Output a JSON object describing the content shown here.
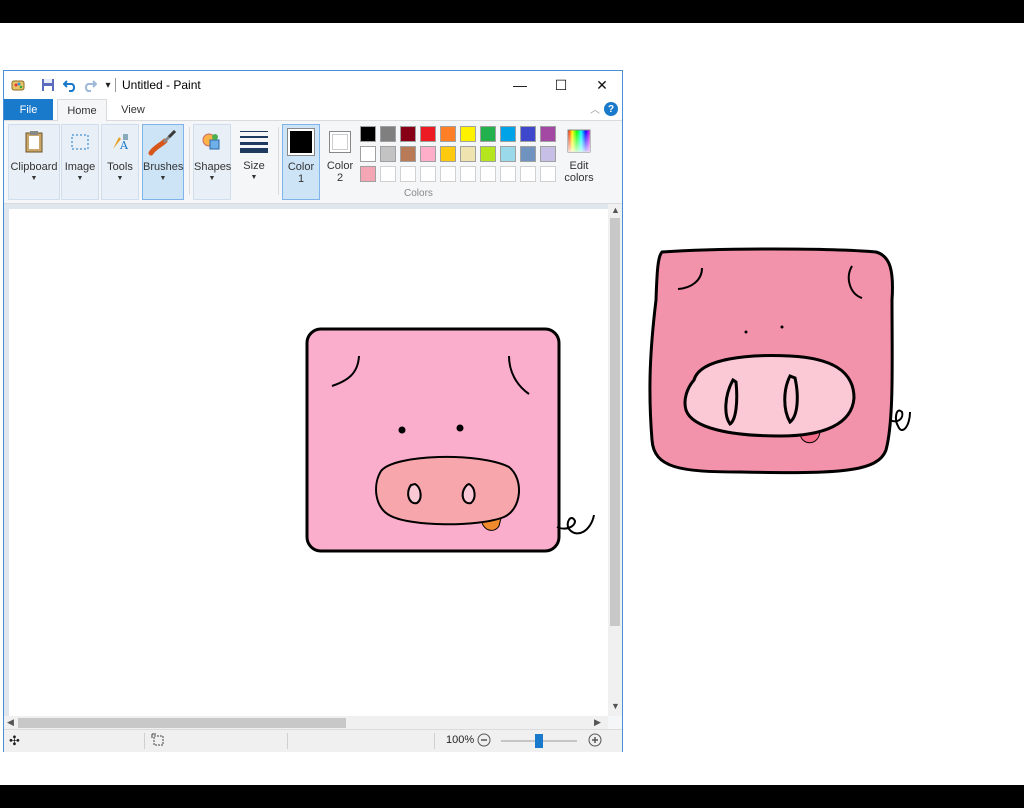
{
  "window": {
    "title": "Untitled - Paint",
    "minimize_glyph": "—",
    "maximize_glyph": "☐",
    "close_glyph": "✕"
  },
  "quick_access": {
    "app_icon": "paint-app-icon",
    "save_icon": "save-icon",
    "undo_icon": "undo-icon",
    "redo_icon": "redo-icon",
    "customize_icon": "customize-dropdown-icon"
  },
  "menu": {
    "file": "File",
    "tabs": [
      {
        "label": "Home",
        "active": true
      },
      {
        "label": "View",
        "active": false
      }
    ],
    "help": "?"
  },
  "ribbon": {
    "groups": [
      {
        "label": "Clipboard",
        "icon": "clipboard-icon"
      },
      {
        "label": "Image",
        "icon": "select-icon"
      },
      {
        "label": "Tools",
        "icon": "tools-icon"
      },
      {
        "label": "Brushes",
        "icon": "brush-icon",
        "active": true
      },
      {
        "label": "Shapes",
        "icon": "shapes-icon"
      },
      {
        "label": "Size",
        "icon": "size-icon"
      }
    ],
    "color1": {
      "line1": "Color",
      "line2": "1",
      "value": "#000000"
    },
    "color2": {
      "line1": "Color",
      "line2": "2",
      "value": "#ffffff"
    },
    "palette_label": "Colors",
    "edit_colors": {
      "line1": "Edit",
      "line2": "colors"
    },
    "palette": [
      [
        "#000000",
        "#7f7f7f",
        "#880015",
        "#ed1c24",
        "#ff7f27",
        "#fff200",
        "#22b14c",
        "#00a2e8",
        "#3f48cc",
        "#a349a4"
      ],
      [
        "#ffffff",
        "#c3c3c3",
        "#b97a57",
        "#ffaec9",
        "#ffc90e",
        "#efe4b0",
        "#b5e61d",
        "#99d9ea",
        "#7092be",
        "#c8bfe7"
      ],
      [
        "#f4a6b4",
        "",
        "",
        "",
        "",
        "",
        "",
        "",
        "",
        ""
      ]
    ]
  },
  "status": {
    "zoom": "100%",
    "zoom_level": 0.5
  },
  "colors": {
    "pig_canvas_fill": "#fbaecb",
    "snout_canvas_fill": "#f7a7ac",
    "tongue_canvas": "#f08a2e",
    "pig_right_fill": "#f393ab",
    "snout_right_fill": "#fbc8d6",
    "tongue_right": "#f46d8b",
    "accent": "#1979ca"
  }
}
